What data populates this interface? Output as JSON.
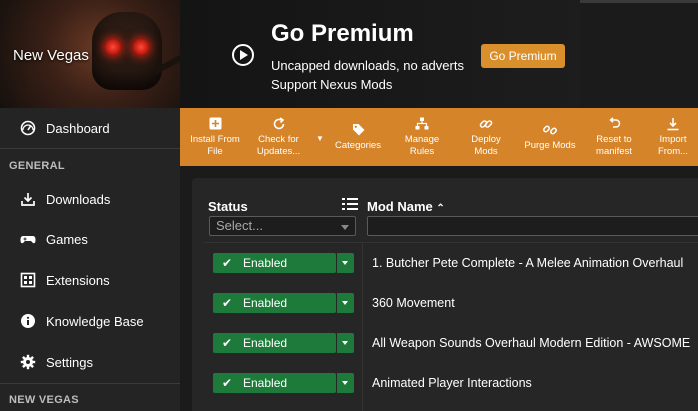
{
  "banner": {
    "game_name": "New Vegas",
    "premium_title": "Go Premium",
    "premium_line1": "Uncapped downloads, no adverts",
    "premium_line2": "Support Nexus Mods",
    "premium_button": "Go Premium"
  },
  "sidebar": {
    "dashboard": "Dashboard",
    "section_general": "GENERAL",
    "items": [
      {
        "label": "Downloads",
        "icon": "download-icon"
      },
      {
        "label": "Games",
        "icon": "gamepad-icon"
      },
      {
        "label": "Extensions",
        "icon": "extensions-icon"
      },
      {
        "label": "Knowledge Base",
        "icon": "info-icon"
      },
      {
        "label": "Settings",
        "icon": "gear-icon"
      }
    ],
    "section_game": "NEW VEGAS"
  },
  "toolbar": {
    "buttons": [
      {
        "line1": "Install From",
        "line2": "File",
        "icon": "plus-square-icon"
      },
      {
        "line1": "Check for",
        "line2": "Updates...",
        "icon": "refresh-icon"
      },
      {
        "line1": "Categories",
        "line2": "",
        "icon": "tag-icon"
      },
      {
        "line1": "Manage",
        "line2": "Rules",
        "icon": "hierarchy-icon"
      },
      {
        "line1": "Deploy",
        "line2": "Mods",
        "icon": "link-icon"
      },
      {
        "line1": "Purge Mods",
        "line2": "",
        "icon": "unlink-icon"
      },
      {
        "line1": "Reset to",
        "line2": "manifest",
        "icon": "undo-icon"
      },
      {
        "line1": "Import",
        "line2": "From...",
        "icon": "import-icon"
      }
    ]
  },
  "mods": {
    "col_status": "Status",
    "col_name": "Mod Name",
    "status_placeholder": "Select...",
    "rows": [
      {
        "status": "Enabled",
        "name": "1. Butcher Pete Complete - A Melee Animation Overhaul"
      },
      {
        "status": "Enabled",
        "name": "360 Movement"
      },
      {
        "status": "Enabled",
        "name": "All Weapon Sounds Overhaul Modern Edition - AWSOME"
      },
      {
        "status": "Enabled",
        "name": "Animated Player Interactions"
      }
    ]
  },
  "colors": {
    "toolbar": "#d5842a",
    "premium_button": "#d98f2b",
    "enabled": "#1d7a3a",
    "sidebar": "#242424"
  }
}
